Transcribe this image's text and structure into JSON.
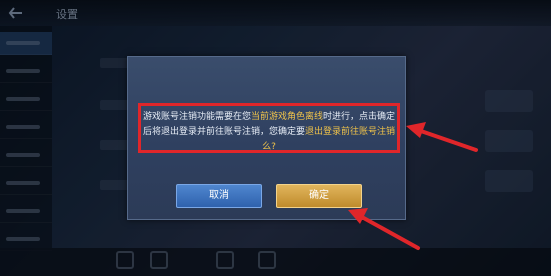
{
  "header": {
    "title": "设置"
  },
  "dialog": {
    "message_part1": "游戏账号注销功能需要在您",
    "message_highlight1": "当前游戏角色离线",
    "message_part2": "时进行，点击确定后将退出登录并前往账号注销，您确定要",
    "message_highlight2": "退出登录前往账号注销么?",
    "cancel_label": "取消",
    "confirm_label": "确定"
  },
  "colors": {
    "highlight": "#f0c34a",
    "annotation_red": "#e0262a",
    "cancel_blue": "#3a72c0",
    "confirm_gold": "#d4a24a"
  }
}
